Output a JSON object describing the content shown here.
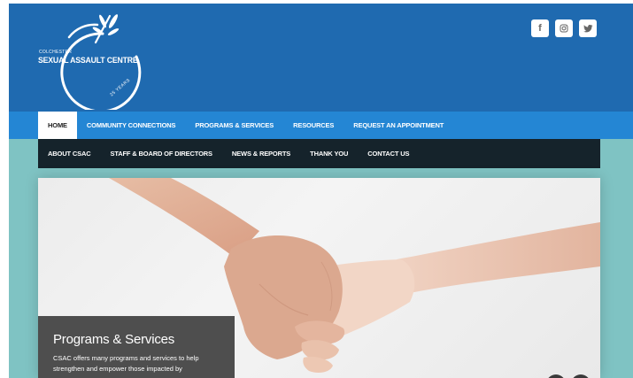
{
  "logo": {
    "small_text": "COLCHESTER",
    "main_text": "SEXUAL ASSAULT CENTRE",
    "years_text": "25 YEARS"
  },
  "social": [
    {
      "icon": "facebook-icon",
      "label": "f"
    },
    {
      "icon": "instagram-icon",
      "label": ""
    },
    {
      "icon": "twitter-icon",
      "label": ""
    }
  ],
  "nav_primary": [
    {
      "label": "HOME",
      "active": true
    },
    {
      "label": "COMMUNITY CONNECTIONS",
      "active": false
    },
    {
      "label": "PROGRAMS & SERVICES",
      "active": false
    },
    {
      "label": "RESOURCES",
      "active": false
    },
    {
      "label": "REQUEST AN APPOINTMENT",
      "active": false
    }
  ],
  "nav_secondary": [
    {
      "label": "ABOUT CSAC"
    },
    {
      "label": "STAFF & BOARD OF DIRECTORS"
    },
    {
      "label": "NEWS & REPORTS"
    },
    {
      "label": "THANK YOU"
    },
    {
      "label": "CONTACT US"
    }
  ],
  "hero": {
    "title": "Programs & Services",
    "text": "CSAC offers many programs and services to help strengthen and empower those impacted by"
  },
  "colors": {
    "header": "#1f6ab0",
    "nav": "#2486d4",
    "subnav": "#15232b",
    "page_bg": "#7fc3c3"
  }
}
